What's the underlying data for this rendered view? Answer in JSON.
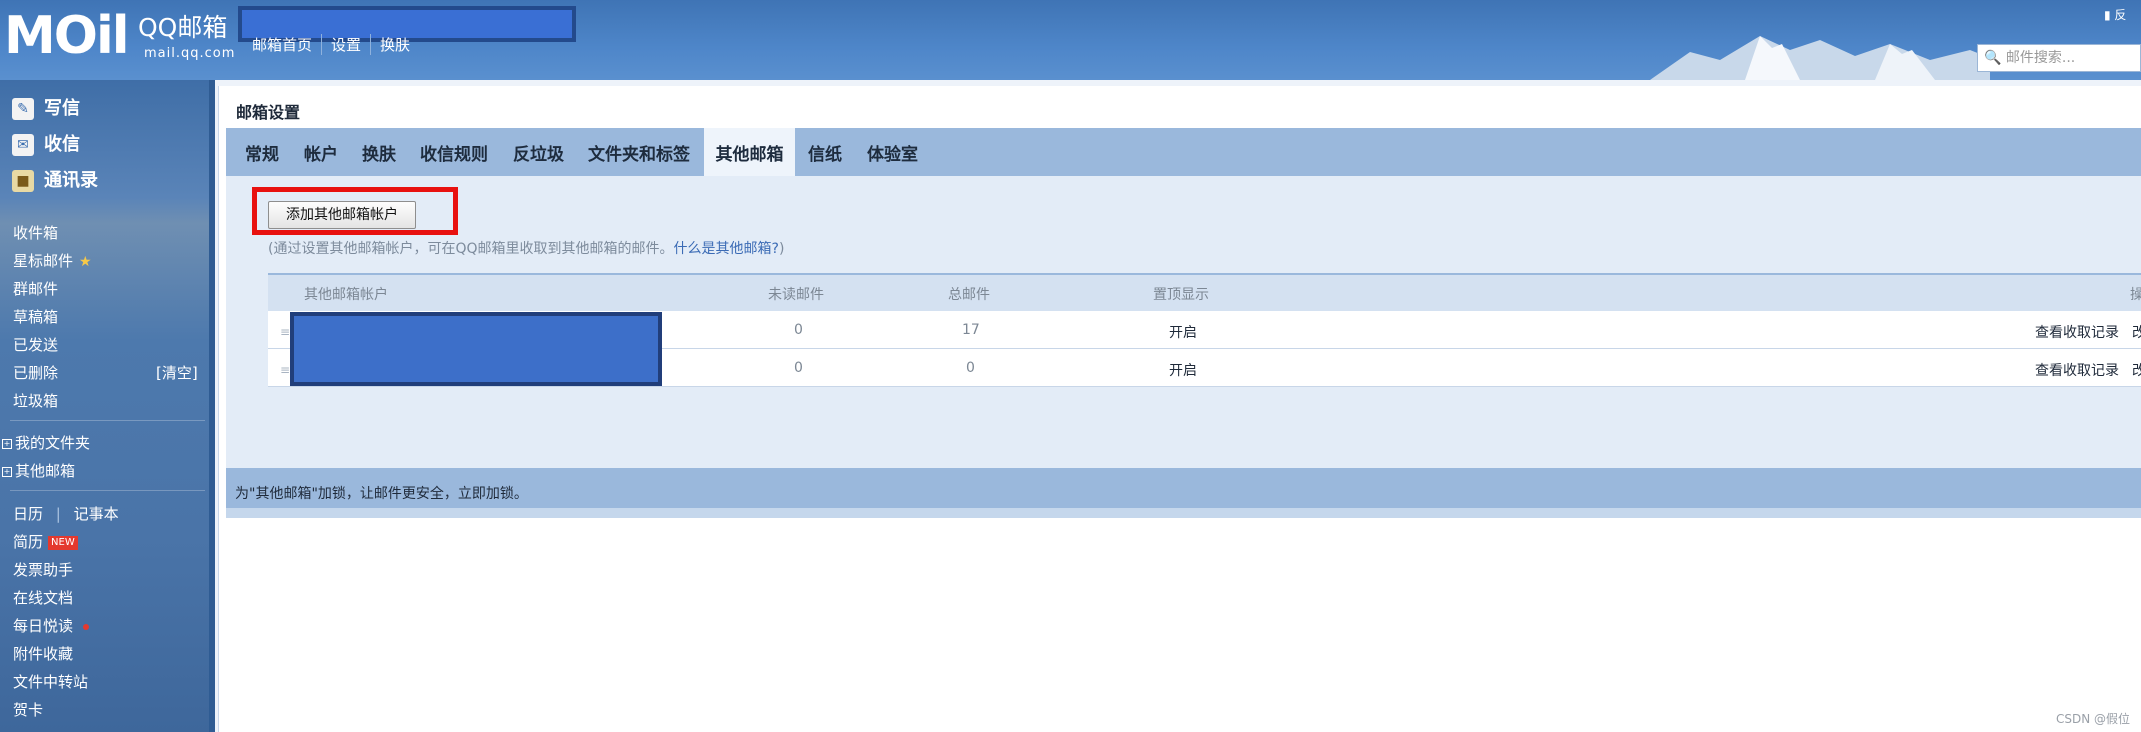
{
  "header": {
    "logo_main": "MOil",
    "logo_cn": "QQ邮箱",
    "logo_url": "mail.qq.com",
    "nav": [
      "邮箱首页",
      "设置",
      "换肤"
    ],
    "search_placeholder": "邮件搜索...",
    "colors": {
      "header_blue": "#4a80c4",
      "accent_red": "#e8110f"
    }
  },
  "sidebar": {
    "actions": [
      {
        "label": "写信",
        "icon": "pencil-icon"
      },
      {
        "label": "收信",
        "icon": "inbox-icon"
      },
      {
        "label": "通讯录",
        "icon": "contacts-icon"
      }
    ],
    "folders": [
      "收件箱",
      "星标邮件",
      "群邮件",
      "草稿箱",
      "已发送",
      "已删除",
      "垃圾箱"
    ],
    "clear_label": "[清空]",
    "groups": [
      "我的文件夹",
      "其他邮箱"
    ],
    "apps": {
      "calendar": "日历",
      "notes": "记事本",
      "resume": "简历",
      "new_badge": "NEW",
      "invoice": "发票助手",
      "docs": "在线文档",
      "daily": "每日悦读",
      "attachments": "附件收藏",
      "transfer": "文件中转站",
      "cards": "贺卡"
    }
  },
  "main": {
    "title": "邮箱设置",
    "tabs": [
      "常规",
      "帐户",
      "换肤",
      "收信规则",
      "反垃圾",
      "文件夹和标签",
      "其他邮箱",
      "信纸",
      "体验室"
    ],
    "active_tab": "其他邮箱",
    "add_button": "添加其他邮箱帐户",
    "hint_prefix": "(通过设置其他邮箱帐户，可在QQ邮箱里收取到其他邮箱的邮件。",
    "hint_link": "什么是其他邮箱?",
    "hint_suffix": ")",
    "table": {
      "headers": [
        "其他邮箱帐户",
        "未读邮件",
        "总邮件",
        "置顶显示",
        "操"
      ],
      "rows": [
        {
          "unread": "0",
          "total": "17",
          "pin": "开启",
          "action": "查看收取记录",
          "action2": "改"
        },
        {
          "unread": "0",
          "total": "0",
          "pin": "开启",
          "action": "查看收取记录",
          "action2": "改"
        }
      ]
    },
    "footer": {
      "text": "为\"其他邮箱\"加锁，让邮件更安全，",
      "link": "立即加锁",
      "end": "。"
    }
  },
  "watermark": "CSDN @假位"
}
